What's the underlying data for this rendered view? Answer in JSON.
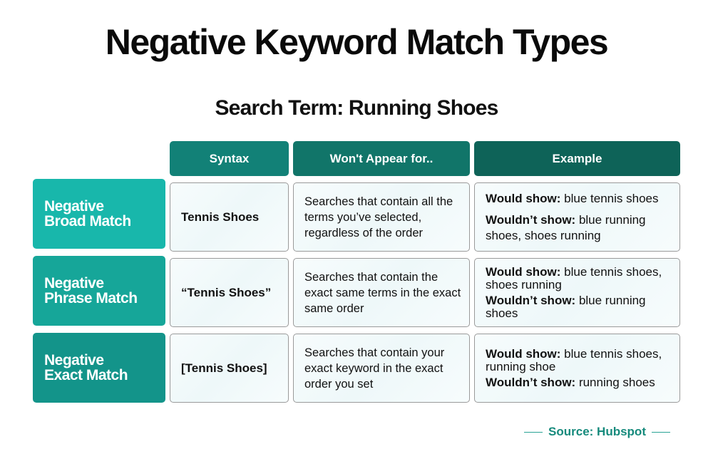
{
  "title": "Negative Keyword Match Types",
  "subtitle": "Search Term: Running Shoes",
  "colors": {
    "header_syntax": "#128177",
    "header_wont": "#117569",
    "header_example": "#0e6358",
    "row_broad": "#18b7ab",
    "row_phrase": "#16a699",
    "row_exact": "#13948a",
    "source": "#168a7c"
  },
  "headers": [
    "Syntax",
    "Won't Appear for..",
    "Example"
  ],
  "rows": [
    {
      "label_line1": "Negative",
      "label_line2": "Broad Match",
      "syntax": "Tennis Shoes",
      "wont_appear": "Searches that contain all the terms you’ve selected, regardless of the order",
      "would_show_label": "Would show:",
      "would_show": " blue tennis shoes",
      "wouldnt_show_label": "Wouldn’t show:",
      "wouldnt_show": " blue running shoes, shoes running"
    },
    {
      "label_line1": "Negative",
      "label_line2": "Phrase Match",
      "syntax": "“Tennis Shoes”",
      "wont_appear": "Searches that contain the exact same terms in the exact same order",
      "would_show_label": "Would show:",
      "would_show": " blue tennis shoes, shoes running",
      "wouldnt_show_label": "Wouldn’t show:",
      "wouldnt_show": " blue running shoes"
    },
    {
      "label_line1": "Negative",
      "label_line2": "Exact Match",
      "syntax": "[Tennis Shoes]",
      "wont_appear": "Searches that contain your exact keyword in the exact order you set",
      "would_show_label": "Would show:",
      "would_show": " blue tennis shoes, running shoe",
      "wouldnt_show_label": "Wouldn’t show:",
      "wouldnt_show": " running shoes"
    }
  ],
  "source": "Source: Hubspot"
}
